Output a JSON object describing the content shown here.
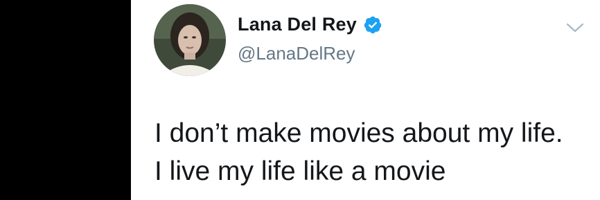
{
  "tweet": {
    "author": {
      "display_name": "Lana Del Rey",
      "handle": "@LanaDelRey",
      "verified": true,
      "avatar_icon": "profile-photo"
    },
    "menu_icon": "chevron-down-icon",
    "text_lines": [
      "I don’t make movies about my life.",
      "I live my life like a movie"
    ]
  },
  "colors": {
    "background_left": "#000000",
    "card": "#ffffff",
    "name": "#14171a",
    "handle": "#657786",
    "verified": "#1da1f2",
    "chevron": "#aab8c2"
  }
}
